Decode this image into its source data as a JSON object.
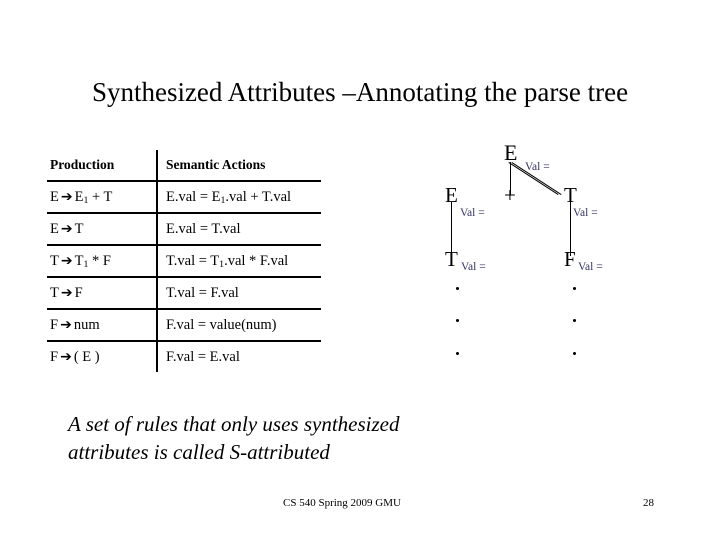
{
  "slide": {
    "title": "Synthesized Attributes –Annotating the parse tree",
    "note_line1": "A set of rules that only uses synthesized",
    "note_line2": "attributes is called S-attributed"
  },
  "table": {
    "headers": {
      "production": "Production",
      "semantic_actions": "Semantic Actions"
    },
    "arrow": "➔",
    "rows": [
      {
        "production_lhs": "E",
        "production_rhs_pre": "E",
        "production_sub": "1",
        "production_rhs_post": " + T",
        "semantic_pre": "E.val = E",
        "semantic_sub": "1",
        "semantic_post": ".val + T.val"
      },
      {
        "production_lhs": "E",
        "production_rhs_pre": "T",
        "production_sub": "",
        "production_rhs_post": "",
        "semantic_pre": "E.val = T.val",
        "semantic_sub": "",
        "semantic_post": ""
      },
      {
        "production_lhs": "T",
        "production_rhs_pre": "T",
        "production_sub": "1",
        "production_rhs_post": " * F",
        "semantic_pre": "T.val = T",
        "semantic_sub": "1",
        "semantic_post": ".val * F.val"
      },
      {
        "production_lhs": "T",
        "production_rhs_pre": "F",
        "production_sub": "",
        "production_rhs_post": "",
        "semantic_pre": "T.val = F.val",
        "semantic_sub": "",
        "semantic_post": ""
      },
      {
        "production_lhs": "F",
        "production_rhs_pre": "num",
        "production_sub": "",
        "production_rhs_post": "",
        "semantic_pre": "F.val = value(num)",
        "semantic_sub": "",
        "semantic_post": ""
      },
      {
        "production_lhs": "F",
        "production_rhs_pre": "( E )",
        "production_sub": "",
        "production_rhs_post": "",
        "semantic_pre": "F.val = E.val",
        "semantic_sub": "",
        "semantic_post": ""
      }
    ]
  },
  "parse_tree": {
    "annotation_color": "#333366",
    "nodes": {
      "root": "E",
      "left_child": "E",
      "middle_child": "+",
      "right_child": "T",
      "left_leaf": "T",
      "right_leaf": "F"
    },
    "annotations": {
      "root_val": "Val =",
      "left_child_val": "Val =",
      "right_child_val": "Val =",
      "left_leaf_val": "Val =",
      "right_leaf_val": "Val ="
    }
  },
  "footer": {
    "course": "CS 540 Spring 2009 GMU",
    "page_number": "28"
  }
}
